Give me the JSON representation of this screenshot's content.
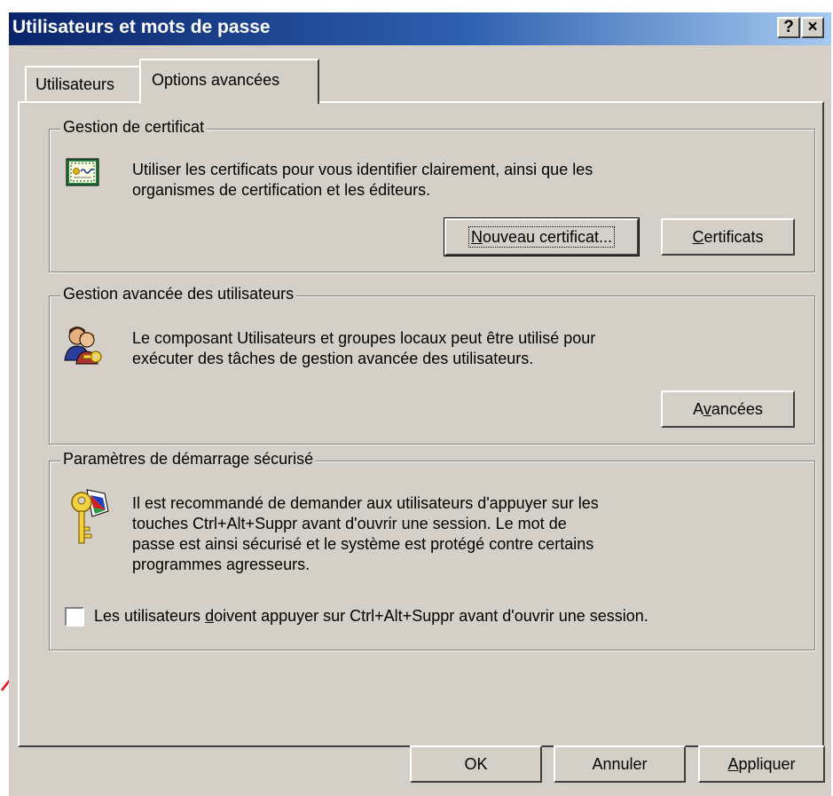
{
  "window": {
    "title": "Utilisateurs et mots de passe",
    "help_button": "?",
    "close_button": "×"
  },
  "tabs": [
    {
      "label": "Utilisateurs",
      "active": false
    },
    {
      "label": "Options avancées",
      "active": true
    }
  ],
  "certificates": {
    "legend": "Gestion de certificat",
    "description": [
      "Utiliser les certificats pour vous identifier clairement, ainsi que les",
      "organismes de certification et les éditeurs."
    ],
    "new_certificate_pre": "",
    "new_certificate_key": "N",
    "new_certificate_post": "ouveau certificat...",
    "certificates_pre": "",
    "certificates_key": "C",
    "certificates_post": "ertificats"
  },
  "advanced_users": {
    "legend": "Gestion avancée des utilisateurs",
    "description": [
      "Le composant Utilisateurs et groupes locaux peut être utilisé pour",
      "exécuter des tâches de gestion avancée des utilisateurs."
    ],
    "advanced_pre": "A",
    "advanced_key": "v",
    "advanced_post": "ancées"
  },
  "secure_boot": {
    "legend": "Paramètres de démarrage sécurisé",
    "description": [
      "Il est recommandé de demander aux utilisateurs d'appuyer sur les",
      "touches Ctrl+Alt+Suppr avant d'ouvrir une session. Le mot de",
      "passe est ainsi sécurisé et le système est protégé contre certains",
      "programmes agresseurs."
    ],
    "checkbox_pre": "Les utilisateurs ",
    "checkbox_key": "d",
    "checkbox_post": "oivent appuyer sur Ctrl+Alt+Suppr avant d'ouvrir une session.",
    "checked": false
  },
  "footer": {
    "ok": "OK",
    "cancel": "Annuler",
    "apply_key": "A",
    "apply_post": "ppliquer"
  },
  "colors": {
    "annotation_arrow": "#e8101a",
    "title_bar_start": "#0a246a",
    "title_bar_end": "#a6caf0"
  },
  "icons": {
    "certificate": "certificate-icon",
    "users": "users-key-icon",
    "secure_key": "key-icon",
    "annotation": "red-arrow"
  }
}
